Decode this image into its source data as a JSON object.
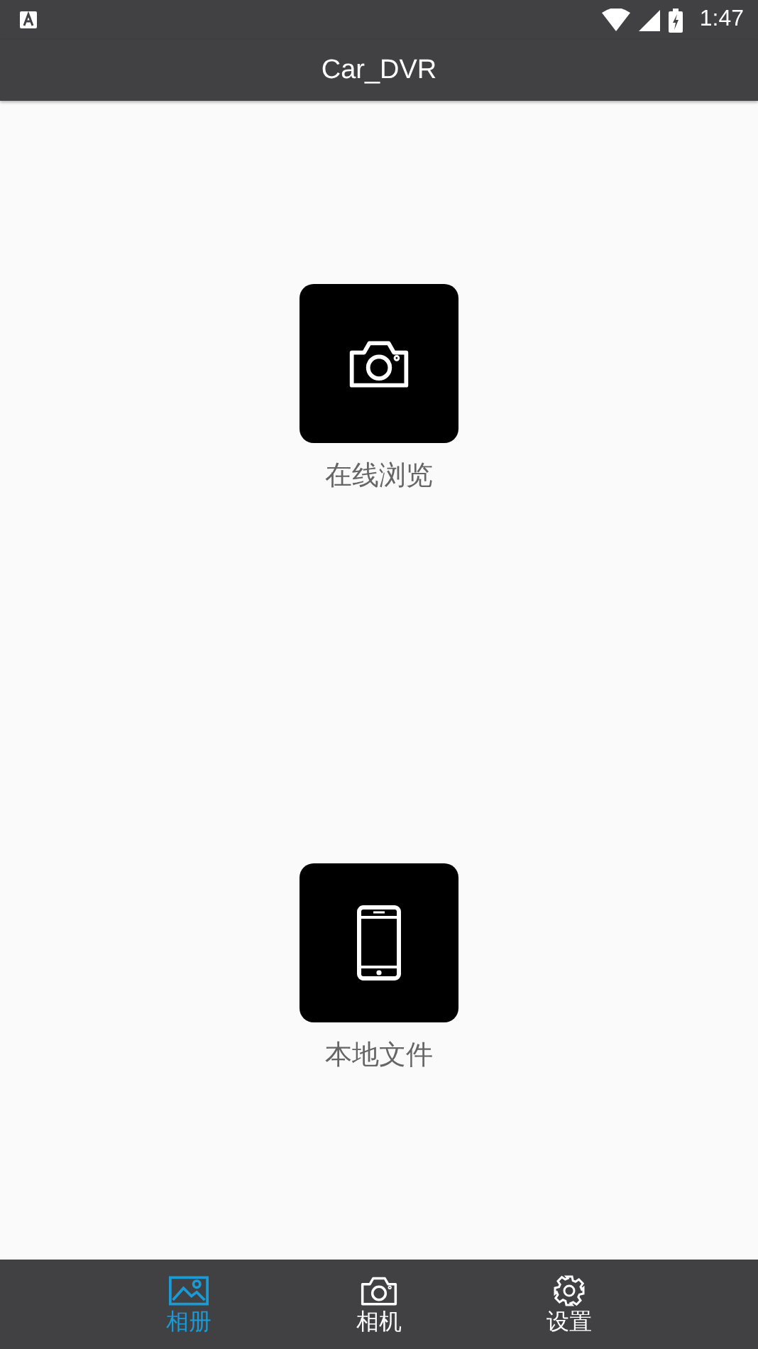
{
  "status_bar": {
    "time": "1:47"
  },
  "app_bar": {
    "title": "Car_DVR"
  },
  "tiles": [
    {
      "kind": "camera",
      "label": "在线浏览"
    },
    {
      "kind": "phone",
      "label": "本地文件"
    }
  ],
  "bottom_nav": [
    {
      "kind": "album",
      "label": "相册",
      "selected": true
    },
    {
      "kind": "camera",
      "label": "相机",
      "selected": false
    },
    {
      "kind": "settings",
      "label": "设置",
      "selected": false
    }
  ]
}
